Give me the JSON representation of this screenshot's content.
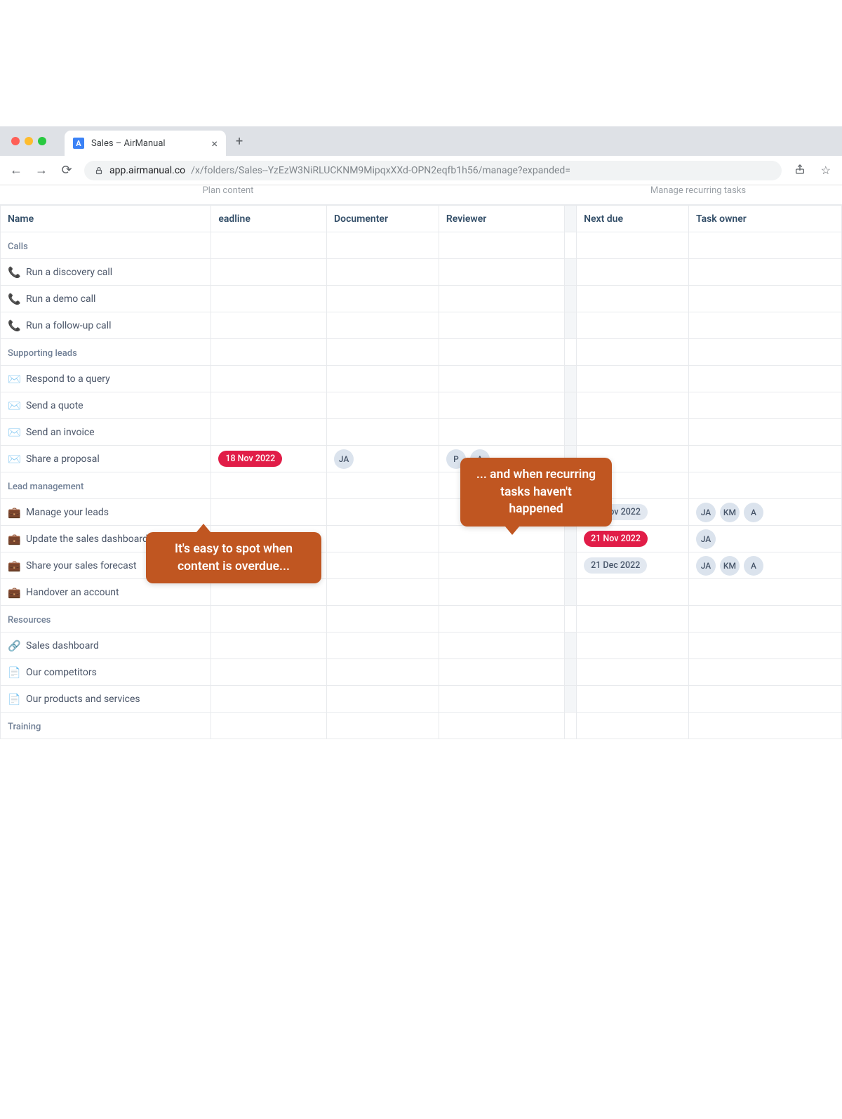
{
  "browser": {
    "tab_title": "Sales – AirManual",
    "favicon_letter": "A",
    "url_host": "app.airmanual.co",
    "url_path": "/x/folders/Sales--YzEzW3NiRLUCKNM9MipqxXXd-OPN2eqfb1h56/manage?expanded="
  },
  "section_labels": {
    "plan": "Plan content",
    "manage": "Manage recurring tasks"
  },
  "columns": {
    "name": "Name",
    "deadline": "eadline",
    "documenter": "Documenter",
    "reviewer": "Reviewer",
    "next_due": "Next due",
    "task_owner": "Task owner"
  },
  "groups": [
    {
      "label": "Calls",
      "rows": [
        {
          "icon": "📞",
          "name": "Run a discovery call"
        },
        {
          "icon": "📞",
          "name": "Run a demo call"
        },
        {
          "icon": "📞",
          "name": "Run a follow-up call"
        }
      ]
    },
    {
      "label": "Supporting leads",
      "rows": [
        {
          "icon": "✉️",
          "name": "Respond to a query"
        },
        {
          "icon": "✉️",
          "name": "Send a quote"
        },
        {
          "icon": "✉️",
          "name": "Send an invoice"
        },
        {
          "icon": "✉️",
          "name": "Share a proposal",
          "deadline": {
            "text": "18 Nov 2022",
            "style": "red"
          },
          "documenter": [
            "JA"
          ],
          "reviewer": [
            "P",
            "A"
          ]
        }
      ]
    },
    {
      "label": "Lead management",
      "rows": [
        {
          "icon": "💼",
          "name": "Manage your leads",
          "next_due": {
            "text": "28 Nov 2022",
            "style": "grey"
          },
          "task_owner": [
            "JA",
            "KM",
            "A"
          ]
        },
        {
          "icon": "💼",
          "name": "Update the sales dashboard",
          "next_due": {
            "text": "21 Nov 2022",
            "style": "red"
          },
          "task_owner": [
            "JA"
          ]
        },
        {
          "icon": "💼",
          "name": "Share your sales forecast",
          "next_due": {
            "text": "21 Dec 2022",
            "style": "grey"
          },
          "task_owner": [
            "JA",
            "KM",
            "A"
          ]
        },
        {
          "icon": "💼",
          "name": "Handover an account"
        }
      ]
    },
    {
      "label": "Resources",
      "rows": [
        {
          "icon": "🔗",
          "name": "Sales dashboard"
        },
        {
          "icon": "📄",
          "name": "Our competitors"
        },
        {
          "icon": "📄",
          "name": "Our products and services"
        }
      ]
    },
    {
      "label": "Training",
      "rows": []
    }
  ],
  "callouts": {
    "c1": "It's easy to spot when content is overdue...",
    "c2": "... and when recurring tasks haven't happened"
  }
}
